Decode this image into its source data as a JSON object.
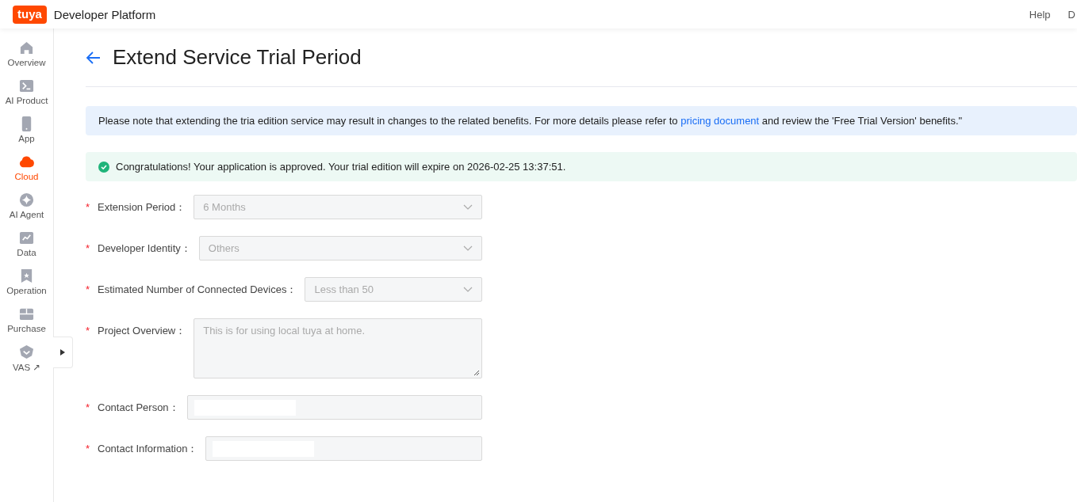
{
  "header": {
    "logo": "tuya",
    "title": "Developer Platform",
    "links": [
      "Help",
      "D"
    ]
  },
  "sidebar": {
    "items": [
      {
        "label": "Overview",
        "kind": "home",
        "selected": false
      },
      {
        "label": "AI Product",
        "kind": "terminal",
        "selected": false
      },
      {
        "label": "App",
        "kind": "phone",
        "selected": false
      },
      {
        "label": "Cloud",
        "kind": "cloud",
        "selected": true
      },
      {
        "label": "AI Agent",
        "kind": "sparkle",
        "selected": false
      },
      {
        "label": "Data",
        "kind": "chart",
        "selected": false
      },
      {
        "label": "Operation",
        "kind": "bookmark",
        "selected": false
      },
      {
        "label": "Purchase",
        "kind": "box",
        "selected": false
      },
      {
        "label": "VAS ↗",
        "kind": "gem",
        "selected": false
      }
    ]
  },
  "page": {
    "title": "Extend Service Trial Period",
    "notice": {
      "before": "Please note that extending the tria edition service may result in changes to the related benefits. For more details please refer to",
      "link": "pricing document",
      "after": "and review the 'Free Trial Version' benefits.\""
    },
    "success": "Congratulations! Your application is approved. Your trial edition will expire on 2026-02-25 13:37:51.",
    "form": [
      {
        "required": "*",
        "label": "Extension Period：",
        "kind": "select",
        "value": "6 Months",
        "disabled": true
      },
      {
        "required": "*",
        "label": "Developer Identity：",
        "kind": "select",
        "value": "Others",
        "disabled": true
      },
      {
        "required": "*",
        "label": "Estimated Number of Connected Devices：",
        "kind": "select",
        "value": "Less than 50",
        "disabled": true
      },
      {
        "required": "*",
        "label": "Project Overview：",
        "kind": "textarea",
        "value": "This is for using local tuya at home.",
        "disabled": true
      },
      {
        "required": "*",
        "label": "Contact Person：",
        "kind": "input",
        "disabled": true
      },
      {
        "required": "*",
        "label": "Contact Information：",
        "kind": "input",
        "disabled": true
      }
    ]
  }
}
